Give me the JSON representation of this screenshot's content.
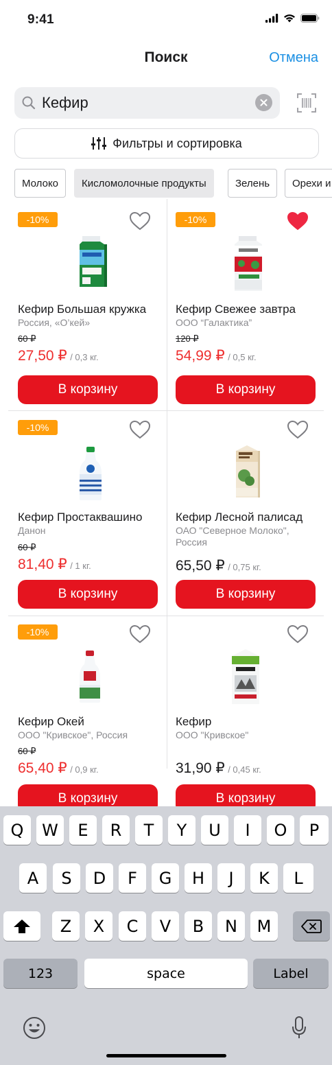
{
  "status_bar": {
    "time": "9:41"
  },
  "nav": {
    "title": "Поиск",
    "cancel_label": "Отмена"
  },
  "search": {
    "value": "Кефир"
  },
  "filters": {
    "label": "Фильтры и сортировка"
  },
  "chips": [
    "Молоко",
    "Кисломолочные продукты",
    "Зелень",
    "Орехи и"
  ],
  "products": [
    {
      "badge": "-10%",
      "name": "Кефир Большая кружка",
      "maker": "Россия, «О’кей»",
      "old_price": "60 ₽",
      "price": "27,50 ₽",
      "unit": "/ 0,3 кг.",
      "cart_label": "В корзину",
      "favorite": false
    },
    {
      "badge": "-10%",
      "name": "Кефир Свежее завтра",
      "maker": "ООО “Галактика”",
      "old_price": "120 ₽",
      "price": "54,99 ₽",
      "unit": "/ 0,5 кг.",
      "cart_label": "В корзину",
      "favorite": true
    },
    {
      "badge": "-10%",
      "name": "Кефир Простаквашино",
      "maker": "Данон",
      "old_price": "60 ₽",
      "price": "81,40 ₽",
      "unit": "/ 1 кг.",
      "cart_label": "В корзину",
      "favorite": false
    },
    {
      "badge": "",
      "name": "Кефир Лесной палисад",
      "maker": "ОАО \"Северное Молоко\", Россия",
      "old_price": "",
      "price": "65,50 ₽",
      "unit": "/ 0,75 кг.",
      "cart_label": "В корзину",
      "favorite": false
    },
    {
      "badge": "-10%",
      "name": "Кефир Окей",
      "maker": "ООО \"Кривское\", Россия",
      "old_price": "60 ₽",
      "price": "65,40 ₽",
      "unit": "/ 0,9 кг.",
      "cart_label": "В корзину",
      "favorite": false
    },
    {
      "badge": "",
      "name": "Кефир",
      "maker": "ООО \"Кривское\"",
      "old_price": "",
      "price": "31,90 ₽",
      "unit": "/ 0,45 кг.",
      "cart_label": "В корзину",
      "favorite": false
    }
  ],
  "keyboard": {
    "row1": [
      "Q",
      "W",
      "E",
      "R",
      "T",
      "Y",
      "U",
      "I",
      "O",
      "P"
    ],
    "row2": [
      "A",
      "S",
      "D",
      "F",
      "G",
      "H",
      "J",
      "K",
      "L"
    ],
    "row3": [
      "Z",
      "X",
      "C",
      "V",
      "B",
      "N",
      "M"
    ],
    "numbers_label": "123",
    "space_label": "space",
    "return_label": "Label"
  },
  "colors": {
    "accent": "#1a8fe3",
    "cart": "#e5141f",
    "badge": "#ff9d0a",
    "sale_price": "#ee2e2e",
    "favorite": "#ee2742"
  },
  "icons": [
    "signal-icon",
    "wifi-icon",
    "battery-icon",
    "search-icon",
    "clear-icon",
    "barcode-icon",
    "filter-icon",
    "heart-icon",
    "shift-icon",
    "backspace-icon",
    "emoji-icon",
    "microphone-icon"
  ]
}
